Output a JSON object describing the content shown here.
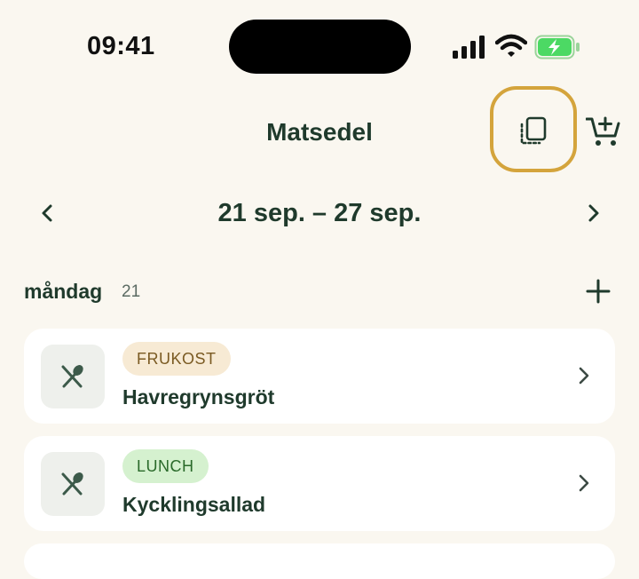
{
  "status_bar": {
    "time": "09:41"
  },
  "header": {
    "title": "Matsedel"
  },
  "week": {
    "range": "21 sep. – 27 sep."
  },
  "day": {
    "name": "måndag",
    "number": "21"
  },
  "meals": [
    {
      "type": "FRUKOST",
      "name": "Havregrynsgröt"
    },
    {
      "type": "LUNCH",
      "name": "Kycklingsallad"
    }
  ],
  "colors": {
    "background": "#faf7f0",
    "primary_text": "#1f3a2c",
    "highlight": "#d4a43c",
    "frukost_badge": "#f7ead4",
    "lunch_badge": "#d5f1cf",
    "battery": "#4cd964"
  },
  "icons": [
    "signal-icon",
    "wifi-icon",
    "battery-icon",
    "copy-icon",
    "cart-add-icon",
    "chevron-left-icon",
    "chevron-right-icon",
    "plus-icon",
    "utensils-icon"
  ]
}
